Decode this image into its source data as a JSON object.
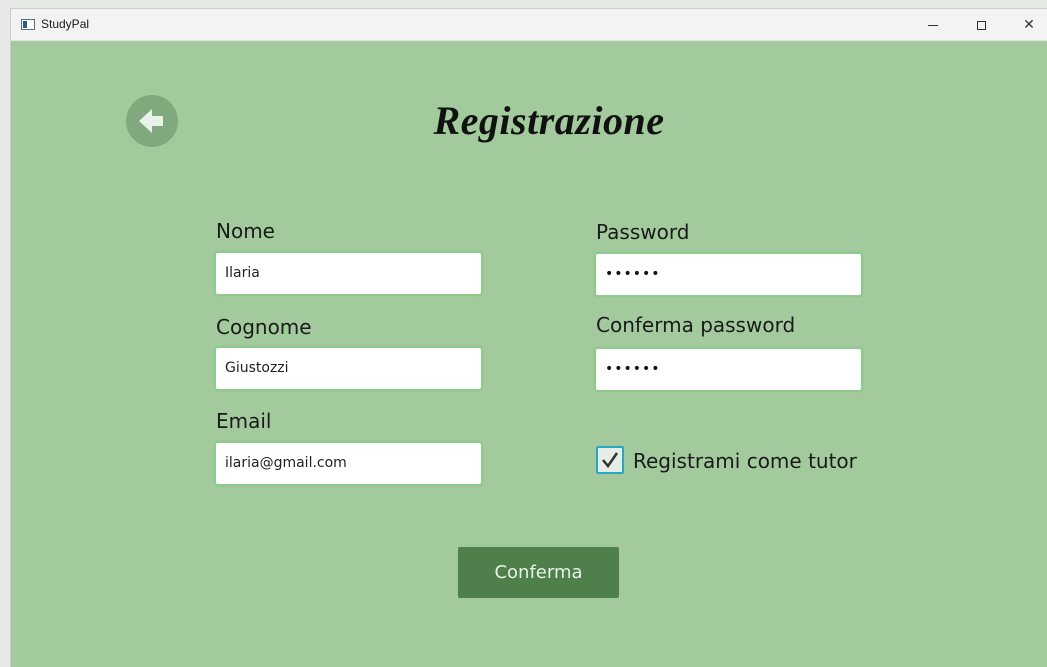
{
  "window": {
    "title": "StudyPal",
    "controls": {
      "minimize_icon": "minimize-icon",
      "maximize_icon": "maximize-icon",
      "close_icon": "close-icon"
    }
  },
  "header": {
    "back_icon": "arrow-left-circle-icon",
    "title": "Registrazione"
  },
  "form": {
    "nome": {
      "label": "Nome",
      "value": "Ilaria"
    },
    "cognome": {
      "label": "Cognome",
      "value": "Giustozzi"
    },
    "email": {
      "label": "Email",
      "value": "ilaria@gmail.com"
    },
    "password": {
      "label": "Password",
      "value": "••••••"
    },
    "conferma_password": {
      "label": "Conferma password",
      "value": "••••••"
    },
    "tutor": {
      "label": "Registrami come tutor",
      "checked": true
    }
  },
  "actions": {
    "confirm_label": "Conferma"
  },
  "colors": {
    "background": "#a2ca9d",
    "button": "#4f7f4a",
    "field_border": "#8ccf8a",
    "checkbox_focus": "#28a7c4"
  }
}
